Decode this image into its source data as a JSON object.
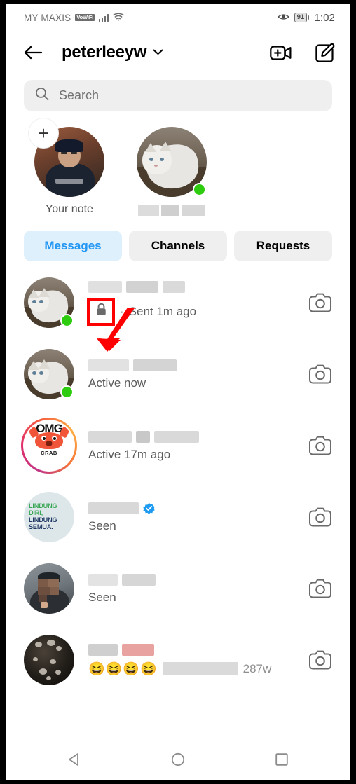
{
  "status_bar": {
    "carrier": "MY MAXIS",
    "vowifi_badge": "VoWiFi",
    "signal_icon": "signal-bars-icon",
    "wifi_icon": "wifi-icon",
    "eye_icon": "eye-icon",
    "battery_level": "91",
    "time": "1:02"
  },
  "header": {
    "back_icon": "back-arrow-icon",
    "username": "peterleeyw",
    "dropdown_icon": "chevron-down-icon",
    "video_call_icon": "new-video-call-icon",
    "compose_icon": "new-message-icon"
  },
  "search": {
    "placeholder": "Search",
    "icon": "search-icon"
  },
  "notes": [
    {
      "label": "Your note",
      "avatar": "person-cap-avatar",
      "has_plus": true,
      "online": false,
      "blurred_name": false
    },
    {
      "label": "",
      "avatar": "cat-avatar",
      "has_plus": false,
      "online": true,
      "blurred_name": true
    }
  ],
  "tabs": [
    {
      "label": "Messages",
      "active": true
    },
    {
      "label": "Channels",
      "active": false
    },
    {
      "label": "Requests",
      "active": false
    }
  ],
  "threads": [
    {
      "avatar": "cat-avatar",
      "online": true,
      "story_ring": false,
      "name_blurred": true,
      "verified": false,
      "lock_icon": "lock-icon",
      "lock_highlighted": true,
      "separator": "·",
      "subtitle": "Sent 1m ago",
      "time": "",
      "emojis": "",
      "camera_icon": "camera-icon"
    },
    {
      "avatar": "cat-avatar",
      "online": true,
      "story_ring": false,
      "name_blurred": true,
      "verified": false,
      "lock_icon": "",
      "lock_highlighted": false,
      "separator": "",
      "subtitle": "Active now",
      "time": "",
      "emojis": "",
      "camera_icon": "camera-icon"
    },
    {
      "avatar": "omg-crab-avatar",
      "online": false,
      "story_ring": true,
      "name_blurred": true,
      "verified": false,
      "lock_icon": "",
      "lock_highlighted": false,
      "separator": "",
      "subtitle": "Active 17m ago",
      "time": "",
      "emojis": "",
      "camera_icon": "camera-icon"
    },
    {
      "avatar": "lindung-diri-avatar",
      "online": false,
      "story_ring": false,
      "name_blurred": true,
      "verified": true,
      "lock_icon": "",
      "lock_highlighted": false,
      "separator": "",
      "subtitle": "Seen",
      "time": "",
      "emojis": "",
      "camera_icon": "camera-icon"
    },
    {
      "avatar": "blurred-person-avatar",
      "online": false,
      "story_ring": false,
      "name_blurred": true,
      "verified": false,
      "lock_icon": "",
      "lock_highlighted": false,
      "separator": "",
      "subtitle": "Seen",
      "time": "",
      "emojis": "",
      "camera_icon": "camera-icon"
    },
    {
      "avatar": "dark-photo-avatar",
      "online": false,
      "story_ring": false,
      "name_blurred": true,
      "verified": false,
      "lock_icon": "",
      "lock_highlighted": false,
      "separator": "",
      "subtitle": "",
      "time": "287w",
      "emojis": "😆😆😆😆",
      "camera_icon": "camera-icon"
    }
  ],
  "annotation": {
    "arrow_color": "#ff0000",
    "highlight_box_color": "#ff0000",
    "target": "lock-icon"
  },
  "avatar_art": {
    "lindung_line1": "LINDUNG",
    "lindung_line2": "DIRI,",
    "lindung_line3": "LINDUNG",
    "lindung_line4": "SEMUA.",
    "crab_top": "OMG",
    "crab_bottom": "CRAB"
  },
  "nav_bar": {
    "back_icon": "nav-back-triangle-icon",
    "home_icon": "nav-home-circle-icon",
    "recents_icon": "nav-recents-square-icon"
  },
  "colors": {
    "accent_blue": "#2196f3",
    "tab_active_bg": "#dff0fd",
    "online_green": "#2ecc0f",
    "search_bg": "#efefef",
    "annotation_red": "#ff0000",
    "verified_blue": "#1d9bf0"
  }
}
